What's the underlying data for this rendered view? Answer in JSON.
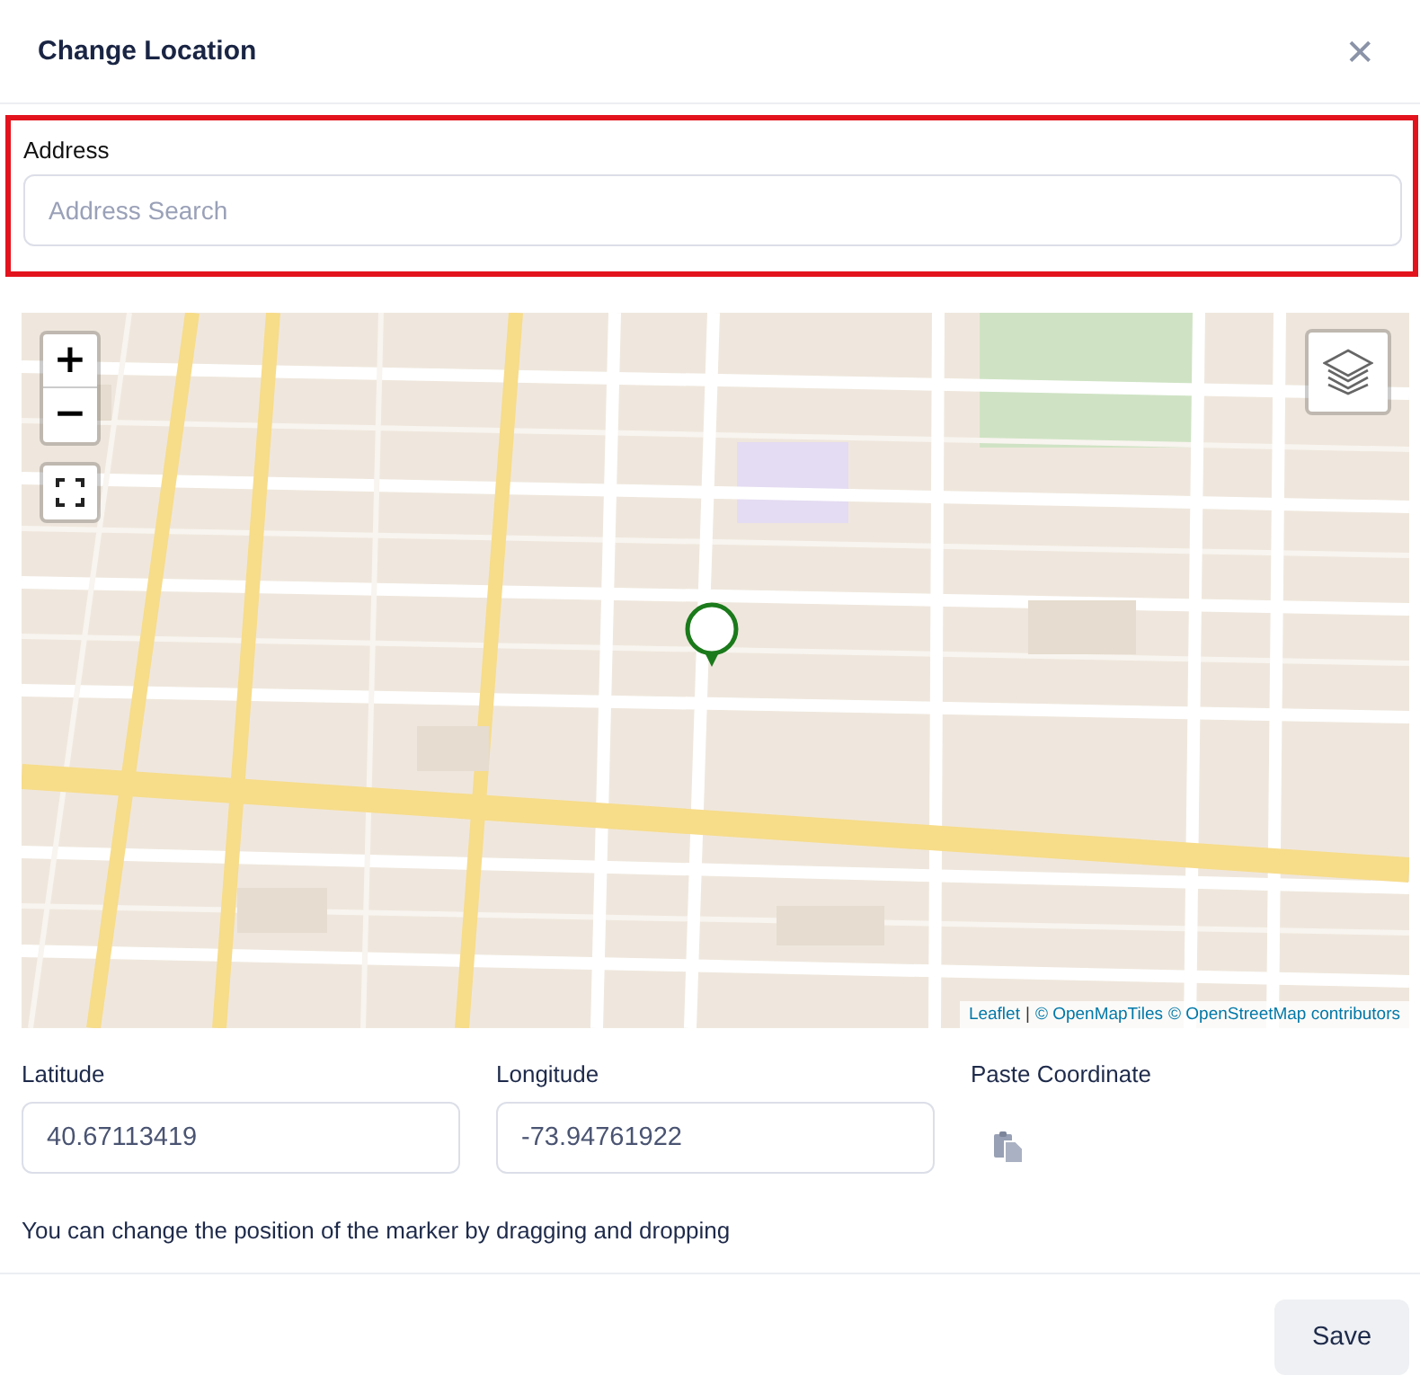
{
  "dialog": {
    "title": "Change Location",
    "close": "✕"
  },
  "address": {
    "label": "Address",
    "placeholder": "Address Search",
    "highlighted": true
  },
  "map": {
    "zoom_in": "+",
    "zoom_out": "−",
    "attribution": [
      {
        "kind": "link",
        "text": "Leaflet"
      },
      {
        "kind": "text",
        "text": "|"
      },
      {
        "kind": "link",
        "text": "© OpenMapTiles"
      },
      {
        "kind": "link",
        "text": "© OpenStreetMap contributors"
      }
    ]
  },
  "coordinates": [
    {
      "label": "Latitude",
      "value": "40.67113419"
    },
    {
      "label": "Longitude",
      "value": "-73.94761922"
    }
  ],
  "paste": {
    "label": "Paste Coordinate"
  },
  "hint": "You can change the position of the marker by dragging and dropping",
  "buttons": [
    "Save"
  ]
}
